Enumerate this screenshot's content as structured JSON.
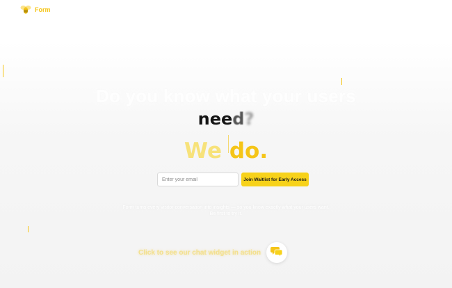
{
  "header": {
    "logo_icon": "bee-icon",
    "logo_text": "Form"
  },
  "hero": {
    "headline": "Do you know what your users",
    "rotating_word_main": "nee",
    "rotating_word_fade": "d",
    "rotating_word_blur": "?",
    "tagline_we": "We",
    "tagline_do": "do."
  },
  "signup": {
    "email_placeholder": "Enter your email",
    "join_label_prefix": "Join Waitlist for ",
    "join_label_strong": "Early Access"
  },
  "subtext": {
    "line1": "Form turns every visitor conversation into insights — so you know exactly what your users want.",
    "line2": "Be first to try it."
  },
  "cta": {
    "text": "Click to see our chat widget in action",
    "chat_icon": "chat-bubbles-icon"
  },
  "colors": {
    "accent": "#f5c518",
    "accent_light": "#f7e27a",
    "button_bg": "#f7d21a"
  }
}
